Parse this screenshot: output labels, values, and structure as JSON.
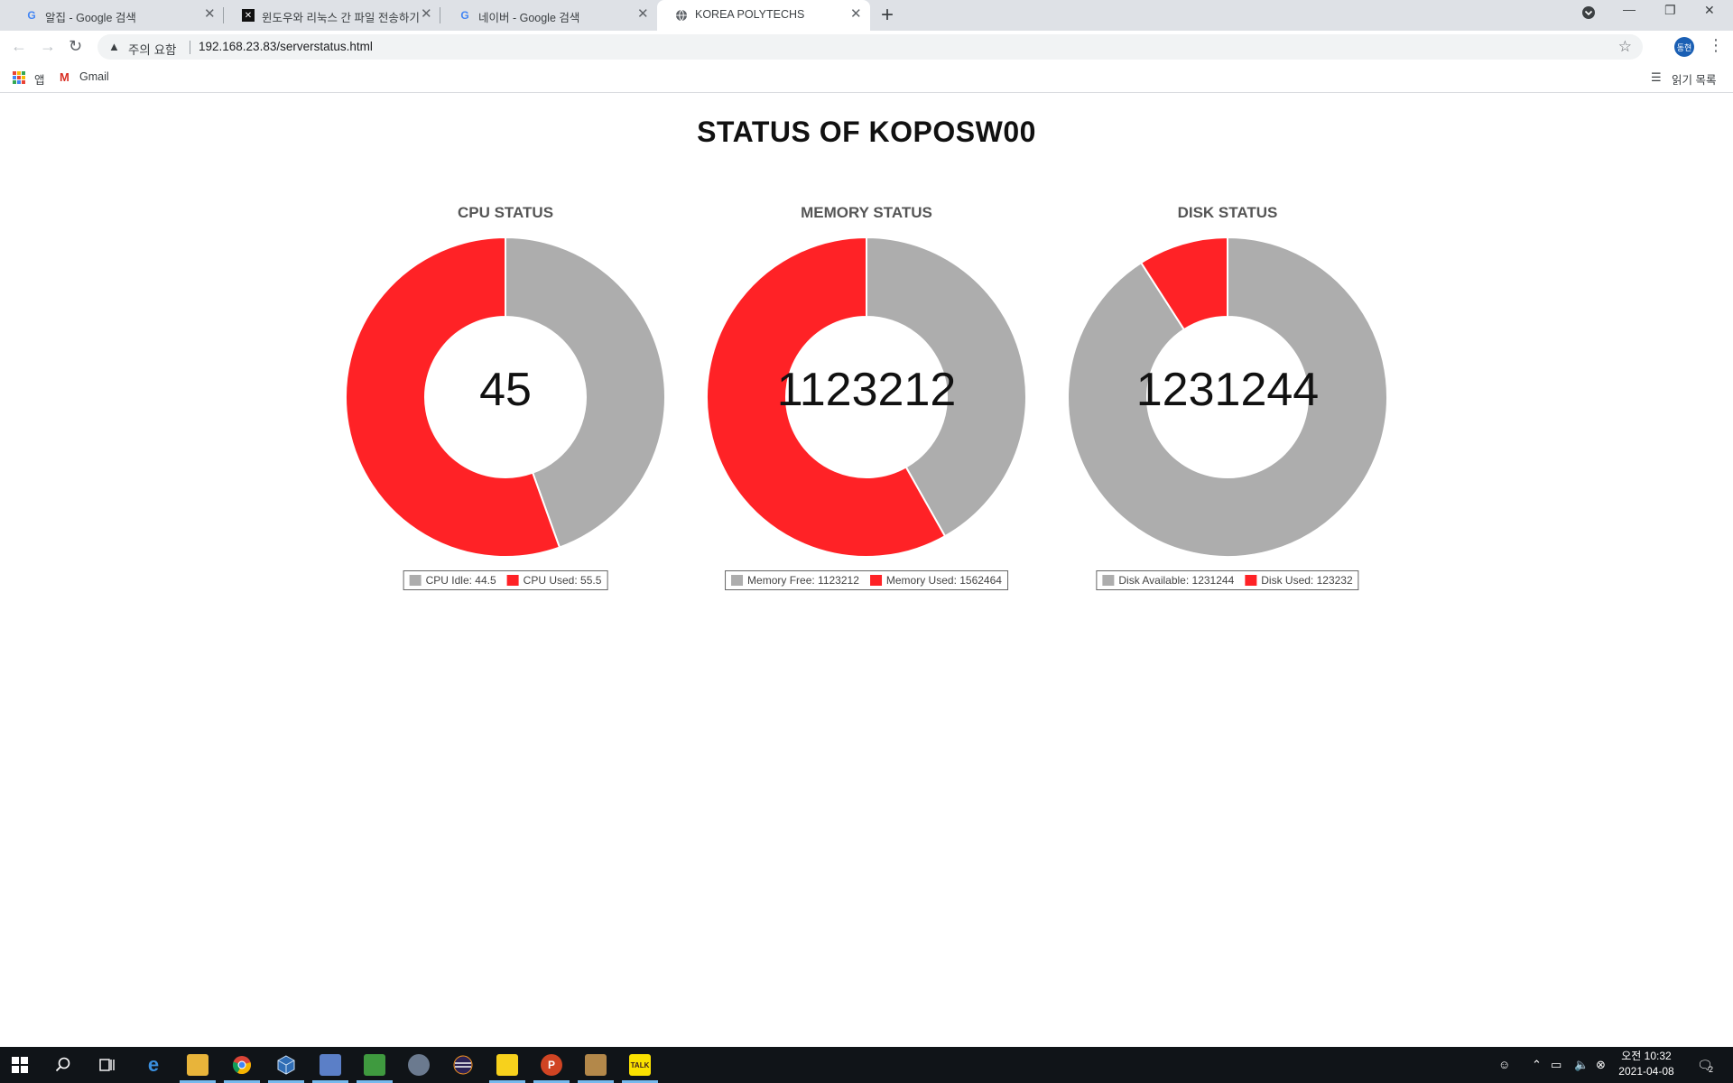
{
  "browser": {
    "tabs": [
      {
        "title": "알집 - Google 검색",
        "favicon": "google-icon"
      },
      {
        "title": "윈도우와 리눅스 간 파일 전송하기",
        "favicon": "x-icon"
      },
      {
        "title": "네이버 - Google 검색",
        "favicon": "google-icon"
      },
      {
        "title": "KOREA POLYTECHS",
        "favicon": "globe-icon",
        "active": true
      }
    ],
    "security_label": "주의 요함",
    "url": "192.168.23.83/serverstatus.html",
    "profile_label": "동현",
    "bookmarks": {
      "apps_label": "앱",
      "gmail_label": "Gmail",
      "reading_list_label": "읽기 목록"
    }
  },
  "page": {
    "title": "STATUS OF KOPOSW00"
  },
  "colors": {
    "grey": "#adadad",
    "red": "#ff2226"
  },
  "chart_data": [
    {
      "type": "pie",
      "donut": true,
      "title": "CPU STATUS",
      "center_text": "45",
      "series": [
        {
          "name": "CPU Idle",
          "value": 44.5,
          "color": "#adadad"
        },
        {
          "name": "CPU Used",
          "value": 55.5,
          "color": "#ff2226"
        }
      ],
      "legend_labels": [
        "CPU Idle: 44.5",
        "CPU Used: 55.5"
      ],
      "legend_position": "bottom"
    },
    {
      "type": "pie",
      "donut": true,
      "title": "MEMORY STATUS",
      "center_text": "1123212",
      "series": [
        {
          "name": "Memory Free",
          "value": 1123212,
          "color": "#adadad"
        },
        {
          "name": "Memory Used",
          "value": 1562464,
          "color": "#ff2226"
        }
      ],
      "legend_labels": [
        "Memory Free: 1123212",
        "Memory Used: 1562464"
      ],
      "legend_position": "bottom"
    },
    {
      "type": "pie",
      "donut": true,
      "title": "DISK STATUS",
      "center_text": "1231244",
      "series": [
        {
          "name": "Disk Available",
          "value": 1231244,
          "color": "#adadad"
        },
        {
          "name": "Disk Used",
          "value": 123232,
          "color": "#ff2226"
        }
      ],
      "legend_labels": [
        "Disk Available: 1231244",
        "Disk Used: 123232"
      ],
      "legend_position": "bottom"
    }
  ],
  "taskbar": {
    "clock_time": "오전 10:32",
    "clock_date": "2021-04-08",
    "notification_count": "2"
  }
}
